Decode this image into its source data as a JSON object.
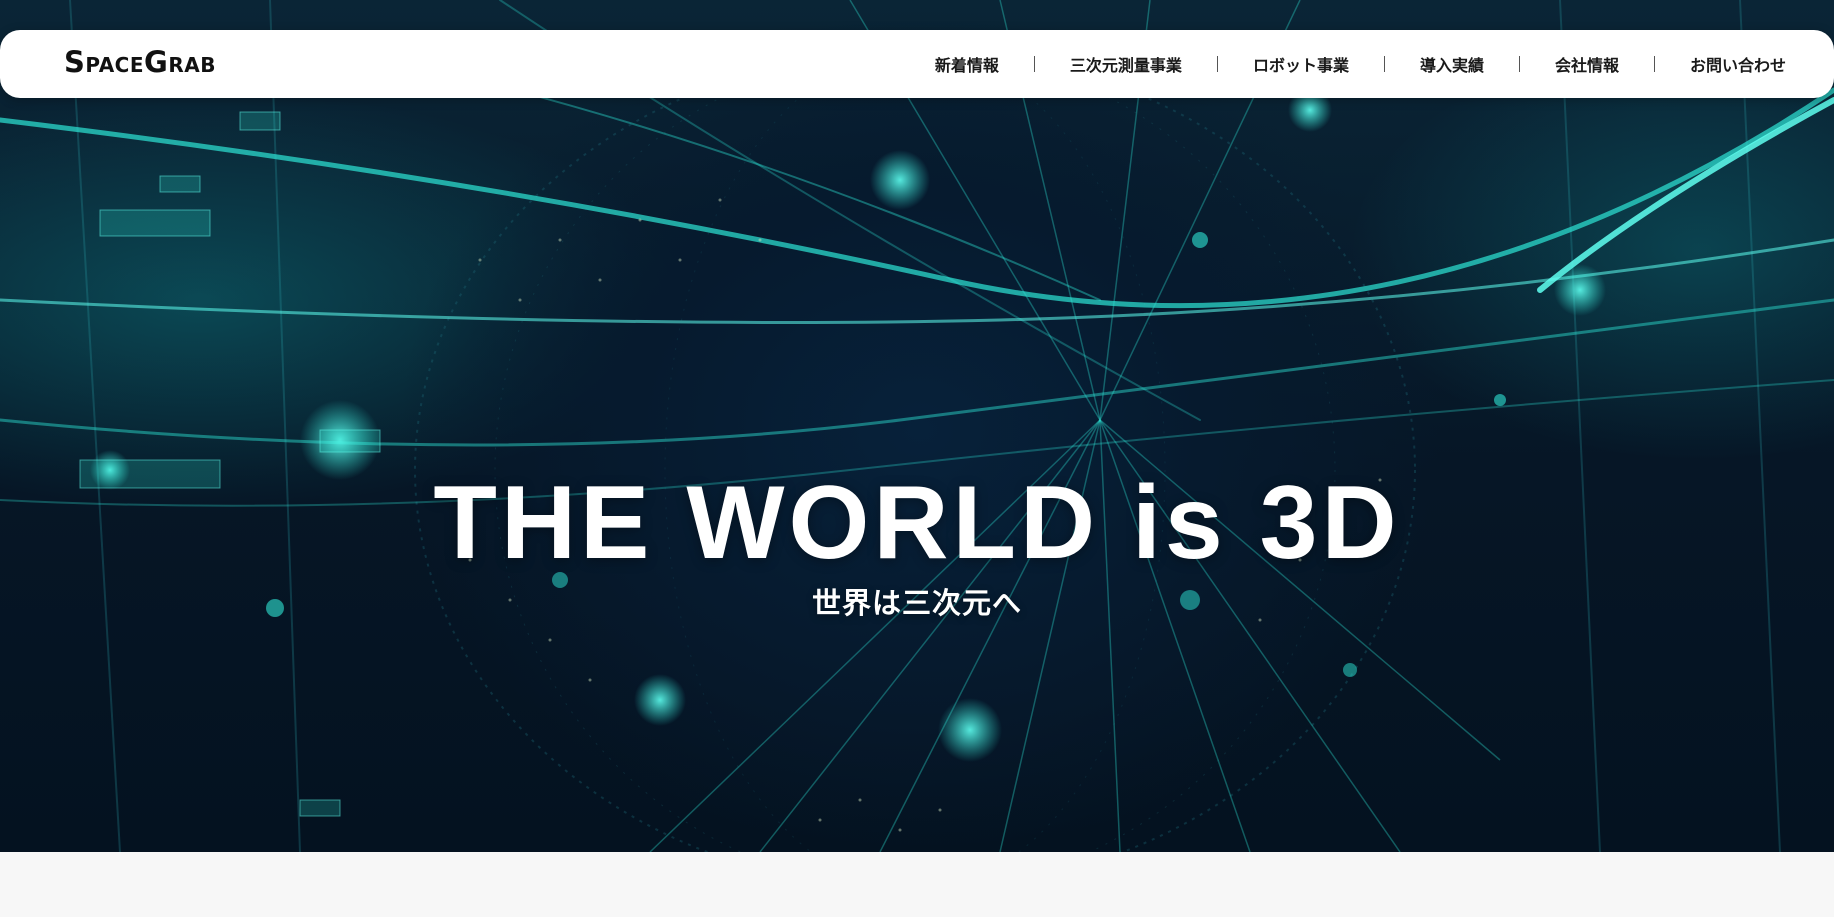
{
  "header": {
    "logo": "SpaceGrab",
    "nav": [
      {
        "label": "新着情報"
      },
      {
        "label": "三次元測量事業"
      },
      {
        "label": "ロボット事業"
      },
      {
        "label": "導入実績"
      },
      {
        "label": "会社情報"
      },
      {
        "label": "お問い合わせ"
      }
    ]
  },
  "hero": {
    "headline": "THE WORLD is 3D",
    "subheadline": "世界は三次元へ",
    "background_image": "digital-globe-network"
  },
  "colors": {
    "accent": "#2ee6d6",
    "background_dark": "#061626",
    "navbar": "#ffffff"
  }
}
